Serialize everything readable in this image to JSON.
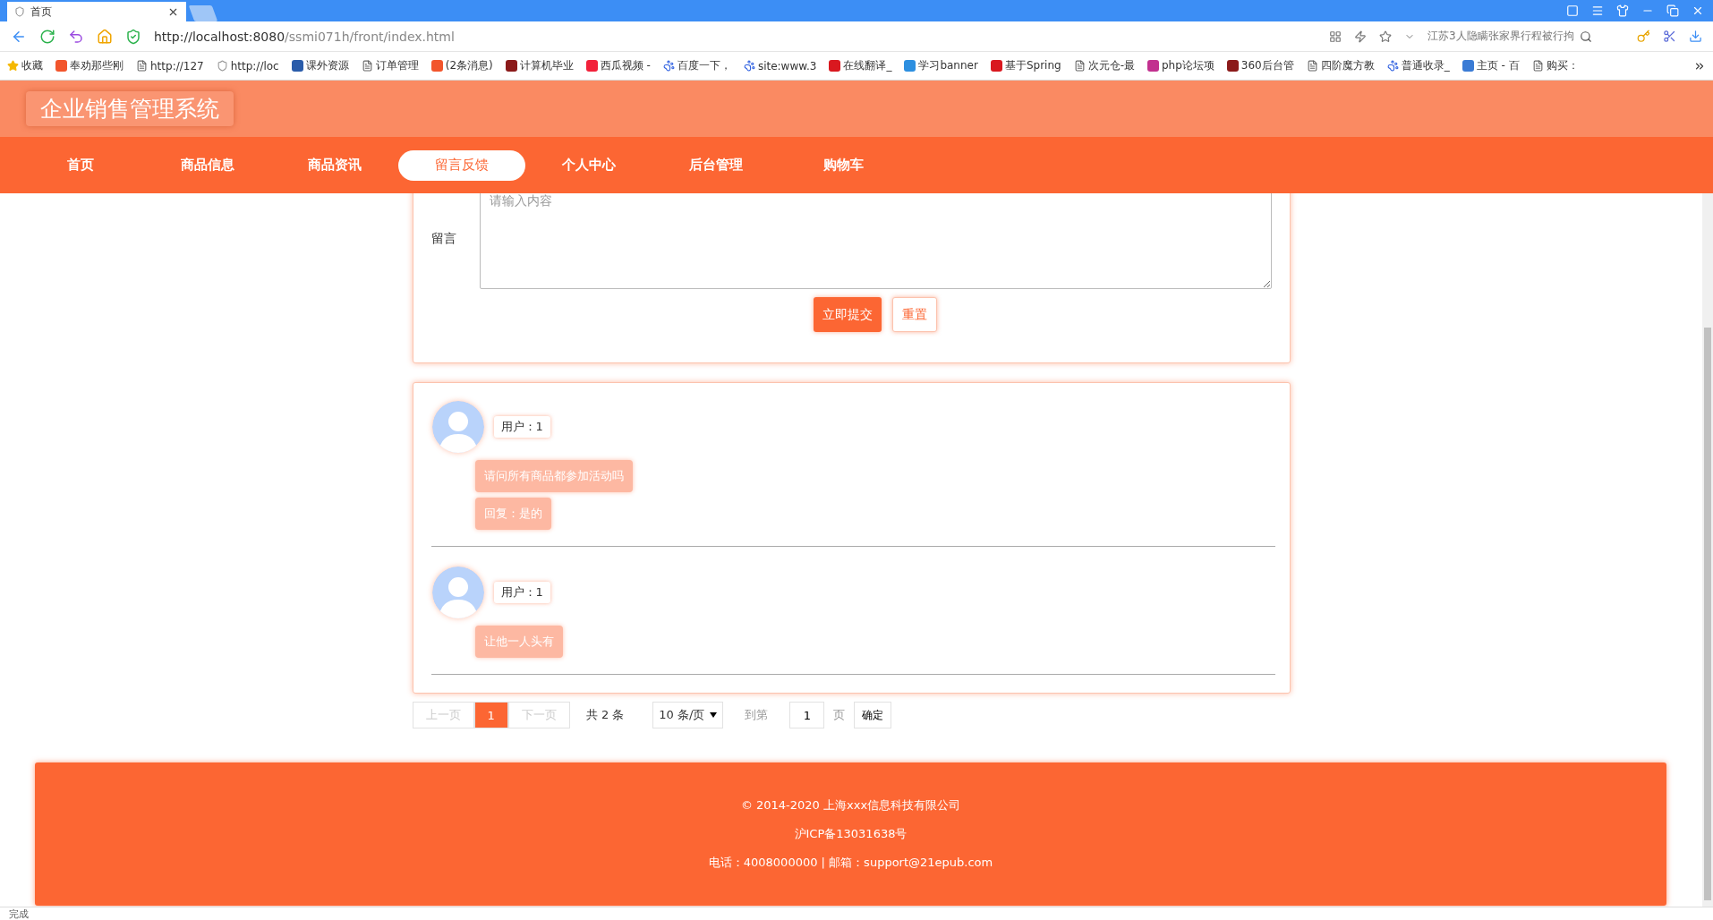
{
  "browser": {
    "tab": {
      "title": "首页",
      "selected": true
    },
    "url": {
      "host": "http://localhost:8080",
      "path": "/ssmi071h/front/index.html"
    },
    "search": {
      "placeholder": "江苏3人隐瞒张家界行程被行拘"
    },
    "bookmarks": [
      {
        "label": "收藏",
        "kind": "star"
      },
      {
        "label": "奉劝那些刚",
        "kind": "badge",
        "color": "#f2552c"
      },
      {
        "label": "http://127",
        "kind": "page"
      },
      {
        "label": "http://loc",
        "kind": "shield"
      },
      {
        "label": "课外资源",
        "kind": "badge",
        "color": "#2a5caa"
      },
      {
        "label": "订单管理",
        "kind": "page"
      },
      {
        "label": "(2条消息)",
        "kind": "badge",
        "color": "#f2552c"
      },
      {
        "label": "计算机毕业",
        "kind": "badge",
        "color": "#8b1a1a"
      },
      {
        "label": "西瓜视频 -",
        "kind": "badge",
        "color": "#f2213a"
      },
      {
        "label": "百度一下，",
        "kind": "paw"
      },
      {
        "label": "site:www.3",
        "kind": "paw"
      },
      {
        "label": "在线翻译_",
        "kind": "badge",
        "color": "#d9181f"
      },
      {
        "label": "学习banner",
        "kind": "badge",
        "color": "#2d8fe0"
      },
      {
        "label": "基于Spring",
        "kind": "badge",
        "color": "#d9181f"
      },
      {
        "label": "次元仓-最",
        "kind": "page"
      },
      {
        "label": "php论坛项",
        "kind": "badge",
        "color": "#c2318f"
      },
      {
        "label": "360后台管",
        "kind": "badge",
        "color": "#8b1a1a"
      },
      {
        "label": "四阶魔方教",
        "kind": "page"
      },
      {
        "label": "普通收录_",
        "kind": "paw"
      },
      {
        "label": "主页 - 百",
        "kind": "badge",
        "color": "#3a7bd5"
      },
      {
        "label": "购买：",
        "kind": "page"
      }
    ],
    "status": "完成"
  },
  "site": {
    "title": "企业销售管理系统",
    "nav": [
      {
        "label": "首页",
        "selected": false
      },
      {
        "label": "商品信息",
        "selected": false
      },
      {
        "label": "商品资讯",
        "selected": false
      },
      {
        "label": "留言反馈",
        "selected": true
      },
      {
        "label": "个人中心",
        "selected": false
      },
      {
        "label": "后台管理",
        "selected": false
      },
      {
        "label": "购物车",
        "selected": false
      }
    ]
  },
  "form": {
    "label": "留言",
    "placeholder": "请输入内容",
    "submit": "立即提交",
    "reset": "重置"
  },
  "messages": [
    {
      "user": "用户：1",
      "content": "请问所有商品都参加活动吗",
      "reply": "回复：是的"
    },
    {
      "user": "用户：1",
      "content": "让他一人头有"
    }
  ],
  "pagination": {
    "prev": {
      "label": "上一页",
      "disabled": true
    },
    "pages": [
      {
        "label": "1",
        "selected": true
      }
    ],
    "next": {
      "label": "下一页",
      "disabled": true
    },
    "total": "共 2 条",
    "page_size": "10 条/页",
    "goto_label": "到第",
    "goto_value": "1",
    "goto_unit": "页",
    "confirm": "确定"
  },
  "footer": [
    "© 2014-2020 上海xxx信息科技有限公司",
    "沪ICP备13031638号",
    "电话：4008000000 | 邮箱：support@21epub.com"
  ]
}
